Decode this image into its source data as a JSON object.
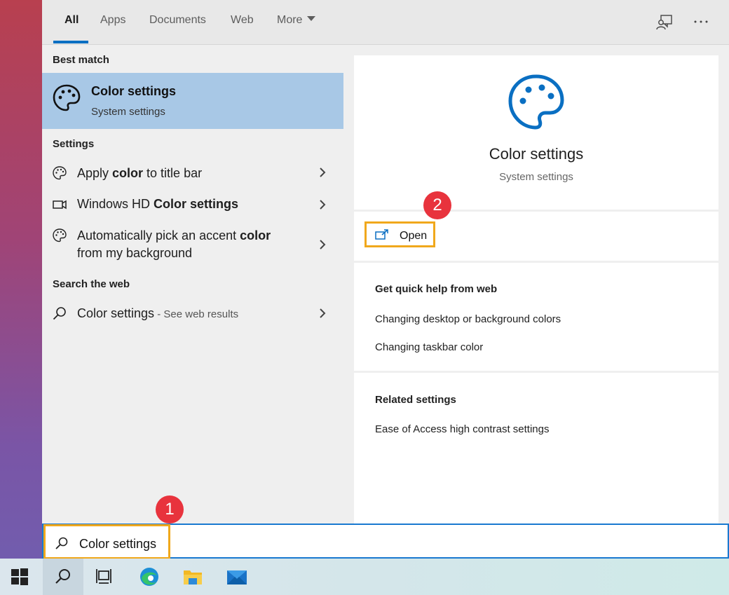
{
  "tabs": [
    {
      "label": "All"
    },
    {
      "label": "Apps"
    },
    {
      "label": "Documents"
    },
    {
      "label": "Web"
    },
    {
      "label": "More"
    }
  ],
  "left": {
    "best_match_header": "Best match",
    "best_match": {
      "title": "Color settings",
      "subtitle": "System settings"
    },
    "settings_header": "Settings",
    "settings_items": [
      {
        "pre": "Apply ",
        "bold": "color",
        "post": " to title bar",
        "icon": "palette-icon"
      },
      {
        "pre": "Windows HD ",
        "bold": "Color settings",
        "post": "",
        "icon": "display-icon"
      },
      {
        "pre": "Automatically pick an accent ",
        "bold": "color",
        "post2": "from my background",
        "icon": "palette-icon"
      }
    ],
    "web_header": "Search the web",
    "web_item": {
      "main": "Color settings",
      "sub": " - See web results"
    }
  },
  "right": {
    "title": "Color settings",
    "subtitle": "System settings",
    "open_label": "Open",
    "quick_help_header": "Get quick help from web",
    "quick_help_links": [
      "Changing desktop or background colors",
      "Changing taskbar color"
    ],
    "related_header": "Related settings",
    "related_links": [
      "Ease of Access high contrast settings"
    ]
  },
  "search": {
    "query": "Color settings"
  },
  "badges": {
    "one": "1",
    "two": "2"
  },
  "colors": {
    "accent": "#0a6fc2",
    "highlight": "#f0a81c",
    "badge": "#e8333d",
    "selection": "#a8c8e6"
  }
}
